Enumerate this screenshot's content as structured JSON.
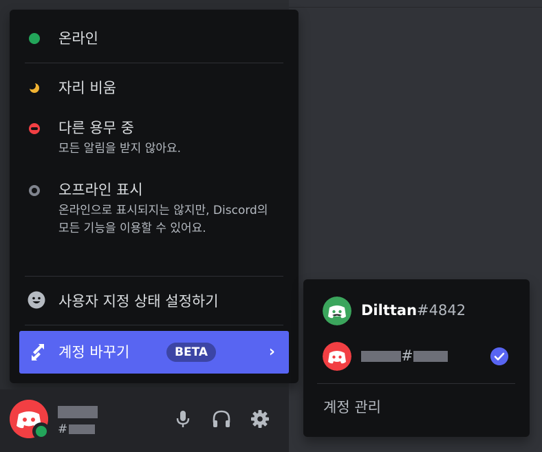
{
  "status_menu": {
    "online": {
      "title": "온라인"
    },
    "idle": {
      "title": "자리 비움"
    },
    "dnd": {
      "title": "다른 용무 중",
      "desc": "모든 알림을 받지 않아요."
    },
    "invisible": {
      "title": "오프라인 표시",
      "desc": "온라인으로 표시되지는 않지만, Discord의 모든 기능을 이용할 수 있어요."
    },
    "custom": {
      "title": "사용자 지정 상태 설정하기"
    },
    "switch": {
      "title": "계정 바꾸기",
      "badge": "BETA"
    }
  },
  "accounts": {
    "items": [
      {
        "username": "Dilttan",
        "tag": "#4842"
      },
      {
        "username": "",
        "tag": "#"
      }
    ],
    "manage_label": "계정 관리"
  },
  "user_panel": {
    "tag_prefix": "#"
  },
  "colors": {
    "accent": "#5865f2",
    "online": "#23a55a",
    "idle": "#f0b232",
    "dnd": "#f23f43",
    "offline": "#80848e"
  }
}
